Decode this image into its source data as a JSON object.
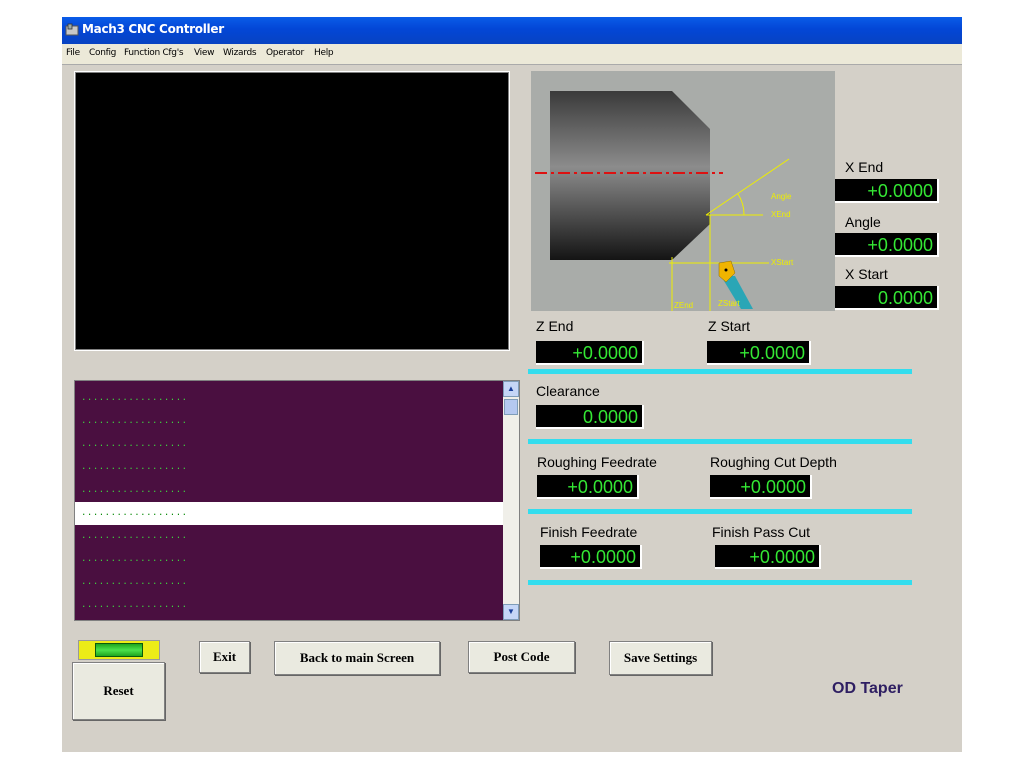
{
  "window": {
    "title": "Mach3 CNC Controller"
  },
  "menu": {
    "items": [
      "File",
      "Config",
      "Function Cfg's",
      "View",
      "Wizards",
      "Operator",
      "Help"
    ]
  },
  "gcode": {
    "lines": [
      "..................",
      "..................",
      "..................",
      "..................",
      "..................",
      "..................",
      "..................",
      "..................",
      "..................",
      ".................."
    ]
  },
  "diagram": {
    "labels": {
      "angle": "Angle",
      "xend": "XEnd",
      "xstart": "XStart",
      "zend": "ZEnd",
      "zstart": "ZStart"
    }
  },
  "fields": {
    "x_end": {
      "label": "X End",
      "value": "+0.0000"
    },
    "angle": {
      "label": "Angle",
      "value": "+0.0000"
    },
    "x_start": {
      "label": "X Start",
      "value": "0.0000"
    },
    "z_end": {
      "label": "Z End",
      "value": "+0.0000"
    },
    "z_start": {
      "label": "Z Start",
      "value": "+0.0000"
    },
    "clearance": {
      "label": "Clearance",
      "value": "0.0000"
    },
    "roughing_feedrate": {
      "label": "Roughing Feedrate",
      "value": "+0.0000"
    },
    "roughing_cut_depth": {
      "label": "Roughing Cut Depth",
      "value": "+0.0000"
    },
    "finish_feedrate": {
      "label": "Finish Feedrate",
      "value": "+0.0000"
    },
    "finish_pass_cut": {
      "label": "Finish Pass Cut",
      "value": "+0.0000"
    }
  },
  "buttons": {
    "reset": "Reset",
    "exit": "Exit",
    "back": "Back to main Screen",
    "post_code": "Post Code",
    "save_settings": "Save Settings"
  },
  "page_name": "OD Taper",
  "colors": {
    "dro_text": "#34e834",
    "accent_line": "#33ddee",
    "gcode_bg": "#4a0f40",
    "titlebar": "#0346d6"
  }
}
